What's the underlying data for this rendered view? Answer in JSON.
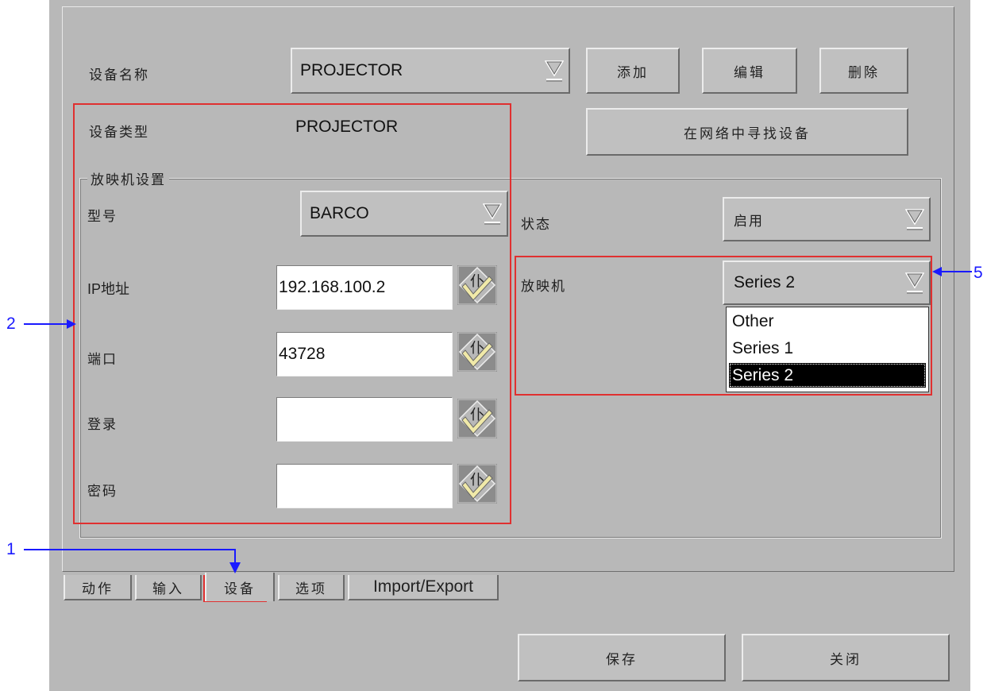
{
  "form": {
    "device_name_label": "设备名称",
    "device_name_value": "PROJECTOR",
    "add_button": "添加",
    "edit_button": "编辑",
    "delete_button": "删除",
    "device_type_label": "设备类型",
    "device_type_value": "PROJECTOR",
    "find_on_network_button": "在网络中寻找设备"
  },
  "projector_settings": {
    "group_title": "放映机设置",
    "model_label": "型号",
    "model_value": "BARCO",
    "ip_label": "IP地址",
    "ip_value": "192.168.100.2",
    "port_label": "端口",
    "port_value": "43728",
    "login_label": "登录",
    "login_value": "",
    "password_label": "密码",
    "password_value": "",
    "status_label": "状态",
    "status_value": "启用",
    "projector_label": "放映机",
    "projector_value": "Series 2",
    "projector_options": [
      "Other",
      "Series 1",
      "Series 2"
    ],
    "projector_selected_index": 2
  },
  "tabs": {
    "actions": "动作",
    "input": "输入",
    "devices": "设备",
    "options": "选项",
    "import_export": "Import/Export",
    "active": "devices"
  },
  "footer": {
    "save_button": "保存",
    "close_button": "关闭"
  },
  "callouts": {
    "c1": "1",
    "c2": "2",
    "c5": "5"
  },
  "colors": {
    "panel_bg": "#b8b8b8",
    "callout_blue": "#1a1aff",
    "highlight_red": "#e03030"
  }
}
